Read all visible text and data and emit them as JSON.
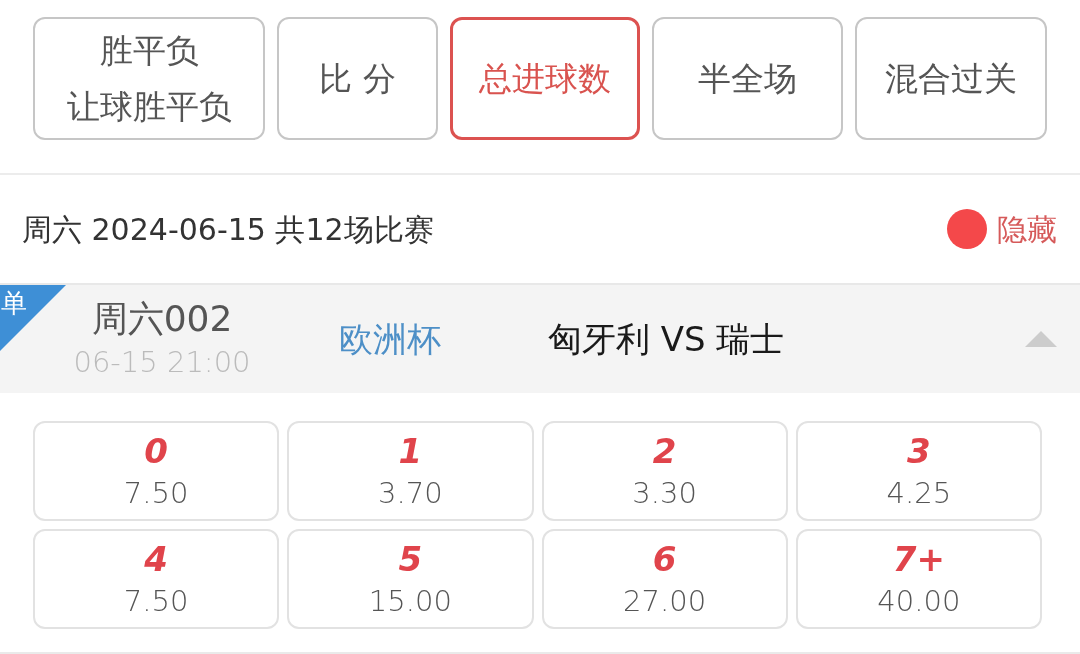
{
  "play_tabs": [
    {
      "lines": [
        "胜平负",
        "让球胜平负"
      ],
      "selected": false
    },
    {
      "lines": [
        "比 分"
      ],
      "selected": false
    },
    {
      "lines": [
        "总进球数"
      ],
      "selected": true
    },
    {
      "lines": [
        "半全场"
      ],
      "selected": false
    },
    {
      "lines": [
        "混合过关"
      ],
      "selected": false
    }
  ],
  "date_header": {
    "text": "周六 2024-06-15 共12场比赛",
    "hide_label": "隐藏"
  },
  "match": {
    "single_badge": "单",
    "number": "周六002",
    "time": "06-15 21:00",
    "league": "欧洲杯",
    "teams": "匈牙利 VS 瑞士",
    "expanded": true,
    "options": [
      {
        "label": "0",
        "odds": "7.50",
        "selected": false
      },
      {
        "label": "1",
        "odds": "3.70",
        "selected": false
      },
      {
        "label": "2",
        "odds": "3.30",
        "selected": false
      },
      {
        "label": "3",
        "odds": "4.25",
        "selected": false
      },
      {
        "label": "4",
        "odds": "7.50",
        "selected": false
      },
      {
        "label": "5",
        "odds": "15.00",
        "selected": false
      },
      {
        "label": "6",
        "odds": "27.00",
        "selected": false
      },
      {
        "label": "7+",
        "odds": "40.00",
        "selected": false
      }
    ]
  }
}
